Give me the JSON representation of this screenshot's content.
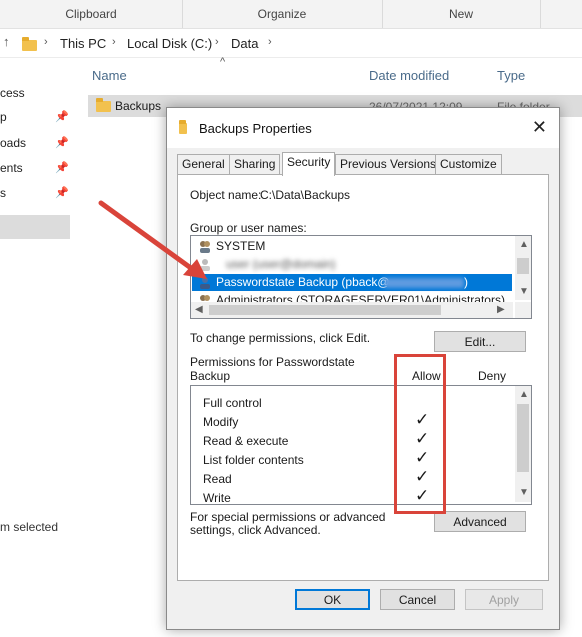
{
  "ribbon": {
    "groups": [
      "Clipboard",
      "Organize",
      "New"
    ]
  },
  "address": {
    "segments": [
      "This PC",
      "Local Disk (C:)",
      "Data"
    ]
  },
  "nav_items": [
    "cess",
    "p",
    "oads",
    "ents",
    "s"
  ],
  "columns": {
    "name": "Name",
    "date": "Date modified",
    "type": "Type"
  },
  "file_row": {
    "name": "Backups",
    "date": "26/07/2021 12:09 ...",
    "type": "File folder"
  },
  "status": {
    "text": "m selected"
  },
  "dialog": {
    "title": "Backups Properties",
    "tabs": [
      "General",
      "Sharing",
      "Security",
      "Previous Versions",
      "Customize"
    ],
    "active_tab": "Security",
    "object_label": "Object name:",
    "object_value": "C:\\Data\\Backups",
    "group_label": "Group or user names:",
    "users": [
      {
        "name": "SYSTEM",
        "selected": false
      },
      {
        "name": "user (user@domain)",
        "selected": false
      },
      {
        "name": "Passwordstate Backup (pback@",
        "selected": true
      },
      {
        "name": "Administrators (STORAGESERVER01\\Administrators)",
        "selected": false
      }
    ],
    "change_text": "To change permissions, click Edit.",
    "edit_button": "Edit...",
    "permissions_for": "Permissions for Passwordstate Backup",
    "allow_col": "Allow",
    "deny_col": "Deny",
    "permissions": [
      {
        "name": "Full control",
        "allow": false
      },
      {
        "name": "Modify",
        "allow": true
      },
      {
        "name": "Read & execute",
        "allow": true
      },
      {
        "name": "List folder contents",
        "allow": true
      },
      {
        "name": "Read",
        "allow": true
      },
      {
        "name": "Write",
        "allow": true
      }
    ],
    "check_glyph": "✓",
    "special_text": "For special permissions or advanced settings, click Advanced.",
    "advanced_button": "Advanced",
    "ok_button": "OK",
    "cancel_button": "Cancel",
    "apply_button": "Apply"
  },
  "colors": {
    "accent": "#0078d7",
    "annotation": "#d9443a",
    "folder": "#f2c14e"
  }
}
